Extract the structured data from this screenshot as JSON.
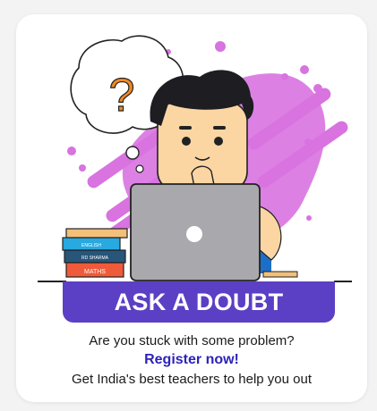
{
  "banner": {
    "title": "ASK A DOUBT"
  },
  "prompt": {
    "question": "Are you stuck with some problem?",
    "cta": "Register now!",
    "subtitle": "Get India's best teachers to help you out"
  },
  "books": {
    "top": "ENGLISH",
    "middle": "RD SHARMA",
    "bottom": "MATHS"
  },
  "thought": {
    "symbol": "?"
  },
  "colors": {
    "banner": "#5b3fc4",
    "cta": "#2f23b8",
    "splash": "#d873e0",
    "question_mark": "#f08a24",
    "laptop": "#a9a9ad",
    "shirt": "#1c6fc7",
    "skin": "#fbd6a3",
    "hair": "#1d1d22"
  },
  "icons": {
    "thought_bubble": "thought-bubble-icon",
    "laptop": "laptop-icon",
    "books": "books-icon"
  }
}
